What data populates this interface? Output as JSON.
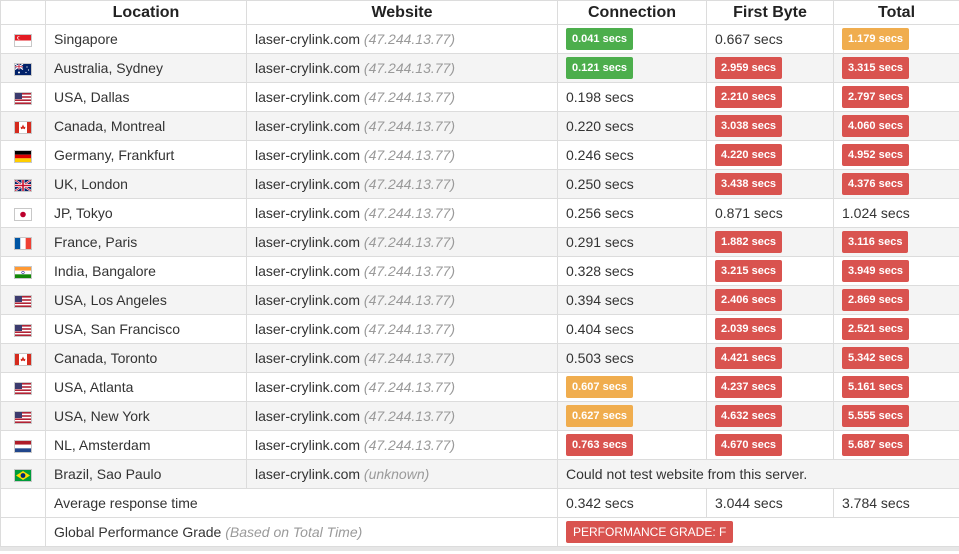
{
  "headers": {
    "location": "Location",
    "website": "Website",
    "connection": "Connection",
    "first_byte": "First Byte",
    "total": "Total"
  },
  "rows": [
    {
      "flag": "sg",
      "location": "Singapore",
      "site": "laser-crylink.com",
      "ip": "(47.244.13.77)",
      "conn": "0.041 secs",
      "conn_style": "green",
      "fb": "0.667 secs",
      "fb_style": "",
      "tot": "1.179 secs",
      "tot_style": "orange"
    },
    {
      "flag": "au",
      "location": "Australia, Sydney",
      "site": "laser-crylink.com",
      "ip": "(47.244.13.77)",
      "conn": "0.121 secs",
      "conn_style": "green",
      "fb": "2.959 secs",
      "fb_style": "red",
      "tot": "3.315 secs",
      "tot_style": "red"
    },
    {
      "flag": "us",
      "location": "USA, Dallas",
      "site": "laser-crylink.com",
      "ip": "(47.244.13.77)",
      "conn": "0.198 secs",
      "conn_style": "",
      "fb": "2.210 secs",
      "fb_style": "red",
      "tot": "2.797 secs",
      "tot_style": "red"
    },
    {
      "flag": "ca",
      "location": "Canada, Montreal",
      "site": "laser-crylink.com",
      "ip": "(47.244.13.77)",
      "conn": "0.220 secs",
      "conn_style": "",
      "fb": "3.038 secs",
      "fb_style": "red",
      "tot": "4.060 secs",
      "tot_style": "red"
    },
    {
      "flag": "de",
      "location": "Germany, Frankfurt",
      "site": "laser-crylink.com",
      "ip": "(47.244.13.77)",
      "conn": "0.246 secs",
      "conn_style": "",
      "fb": "4.220 secs",
      "fb_style": "red",
      "tot": "4.952 secs",
      "tot_style": "red"
    },
    {
      "flag": "uk",
      "location": "UK, London",
      "site": "laser-crylink.com",
      "ip": "(47.244.13.77)",
      "conn": "0.250 secs",
      "conn_style": "",
      "fb": "3.438 secs",
      "fb_style": "red",
      "tot": "4.376 secs",
      "tot_style": "red"
    },
    {
      "flag": "jp",
      "location": "JP, Tokyo",
      "site": "laser-crylink.com",
      "ip": "(47.244.13.77)",
      "conn": "0.256 secs",
      "conn_style": "",
      "fb": "0.871 secs",
      "fb_style": "",
      "tot": "1.024 secs",
      "tot_style": ""
    },
    {
      "flag": "fr",
      "location": "France, Paris",
      "site": "laser-crylink.com",
      "ip": "(47.244.13.77)",
      "conn": "0.291 secs",
      "conn_style": "",
      "fb": "1.882 secs",
      "fb_style": "red",
      "tot": "3.116 secs",
      "tot_style": "red"
    },
    {
      "flag": "in",
      "location": "India, Bangalore",
      "site": "laser-crylink.com",
      "ip": "(47.244.13.77)",
      "conn": "0.328 secs",
      "conn_style": "",
      "fb": "3.215 secs",
      "fb_style": "red",
      "tot": "3.949 secs",
      "tot_style": "red"
    },
    {
      "flag": "us",
      "location": "USA, Los Angeles",
      "site": "laser-crylink.com",
      "ip": "(47.244.13.77)",
      "conn": "0.394 secs",
      "conn_style": "",
      "fb": "2.406 secs",
      "fb_style": "red",
      "tot": "2.869 secs",
      "tot_style": "red"
    },
    {
      "flag": "us",
      "location": "USA, San Francisco",
      "site": "laser-crylink.com",
      "ip": "(47.244.13.77)",
      "conn": "0.404 secs",
      "conn_style": "",
      "fb": "2.039 secs",
      "fb_style": "red",
      "tot": "2.521 secs",
      "tot_style": "red"
    },
    {
      "flag": "ca",
      "location": "Canada, Toronto",
      "site": "laser-crylink.com",
      "ip": "(47.244.13.77)",
      "conn": "0.503 secs",
      "conn_style": "",
      "fb": "4.421 secs",
      "fb_style": "red",
      "tot": "5.342 secs",
      "tot_style": "red"
    },
    {
      "flag": "us",
      "location": "USA, Atlanta",
      "site": "laser-crylink.com",
      "ip": "(47.244.13.77)",
      "conn": "0.607 secs",
      "conn_style": "orange",
      "fb": "4.237 secs",
      "fb_style": "red",
      "tot": "5.161 secs",
      "tot_style": "red"
    },
    {
      "flag": "us",
      "location": "USA, New York",
      "site": "laser-crylink.com",
      "ip": "(47.244.13.77)",
      "conn": "0.627 secs",
      "conn_style": "orange",
      "fb": "4.632 secs",
      "fb_style": "red",
      "tot": "5.555 secs",
      "tot_style": "red"
    },
    {
      "flag": "nl",
      "location": "NL, Amsterdam",
      "site": "laser-crylink.com",
      "ip": "(47.244.13.77)",
      "conn": "0.763 secs",
      "conn_style": "red",
      "fb": "4.670 secs",
      "fb_style": "red",
      "tot": "5.687 secs",
      "tot_style": "red"
    }
  ],
  "brazil": {
    "flag": "br",
    "location": "Brazil, Sao Paulo",
    "site": "laser-crylink.com",
    "ip": "(unknown)",
    "message": "Could not test website from this server."
  },
  "average": {
    "label": "Average response time",
    "conn": "0.342 secs",
    "fb": "3.044 secs",
    "tot": "3.784 secs"
  },
  "grade": {
    "label": "Global Performance Grade",
    "note": "(Based on Total Time)",
    "badge": "PERFORMANCE GRADE:  F"
  },
  "colors": {
    "green": "#4cae4c",
    "orange": "#f0ad4e",
    "red": "#d9534f"
  },
  "flag_icons": {
    "sg": "singapore-flag-icon",
    "au": "australia-flag-icon",
    "us": "usa-flag-icon",
    "ca": "canada-flag-icon",
    "de": "germany-flag-icon",
    "uk": "uk-flag-icon",
    "jp": "japan-flag-icon",
    "fr": "france-flag-icon",
    "in": "india-flag-icon",
    "nl": "netherlands-flag-icon",
    "br": "brazil-flag-icon"
  }
}
